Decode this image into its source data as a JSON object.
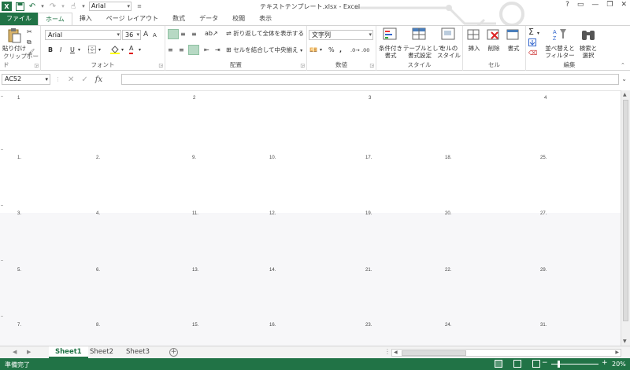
{
  "titlebar": {
    "logo": "X",
    "font_name": "Arial",
    "title": "テキストテンプレート.xlsx - Excel",
    "help": "?",
    "restore_ribbon": "▭",
    "minimize": "—",
    "maximize": "❐",
    "close": "✕"
  },
  "tabs": [
    "ファイル",
    "ホーム",
    "挿入",
    "ページ レイアウト",
    "数式",
    "データ",
    "校閲",
    "表示"
  ],
  "ribbon": {
    "clipboard": {
      "paste": "貼り付け",
      "label": "クリップボード"
    },
    "font": {
      "name": "Arial",
      "size": "36",
      "grow": "A",
      "shrink": "A",
      "bold": "B",
      "italic": "I",
      "underline": "U",
      "color": "A",
      "label": "フォント"
    },
    "alignment": {
      "wrap": "折り返して全体を表示する",
      "merge": "セルを結合して中央揃え",
      "label": "配置"
    },
    "number": {
      "format": "文字列",
      "percent": "%",
      "comma": ",",
      "label": "数値"
    },
    "styles": {
      "conditional": "条件付き\n書式",
      "table": "テーブルとして\n書式設定",
      "cell": "セルの\nスタイル",
      "label": "スタイル"
    },
    "cells": {
      "insert": "挿入",
      "delete": "削除",
      "format": "書式",
      "label": "セル"
    },
    "editing": {
      "sum": "Σ",
      "sort": "並べ替えと\nフィルター",
      "find": "検索と\n選択",
      "label": "編集"
    }
  },
  "formula_bar": {
    "name_box": "AC52",
    "cancel": "✕",
    "enter": "✓",
    "fx": "fx",
    "value": ""
  },
  "sheet": {
    "top_numbers": [
      "1",
      "2",
      "3",
      "4"
    ],
    "rows": [
      [
        "1.",
        "2.",
        "9.",
        "10.",
        "17.",
        "18.",
        "25."
      ],
      [
        "3.",
        "4.",
        "11.",
        "12.",
        "19.",
        "20.",
        "27."
      ],
      [
        "5.",
        "6.",
        "13.",
        "14.",
        "21.",
        "22.",
        "29."
      ],
      [
        "7.",
        "8.",
        "15.",
        "16.",
        "23.",
        "24.",
        "31."
      ]
    ]
  },
  "sheet_tabs": {
    "items": [
      "Sheet1",
      "Sheet2",
      "Sheet3"
    ],
    "active": "Sheet1",
    "add": "+",
    "dots": "⋮"
  },
  "statusbar": {
    "ready": "準備完了",
    "zoom": "20%",
    "zoom_minus": "−",
    "zoom_plus": "+"
  },
  "colors": {
    "accent": "#217346",
    "shade": "#f7f7f9"
  }
}
